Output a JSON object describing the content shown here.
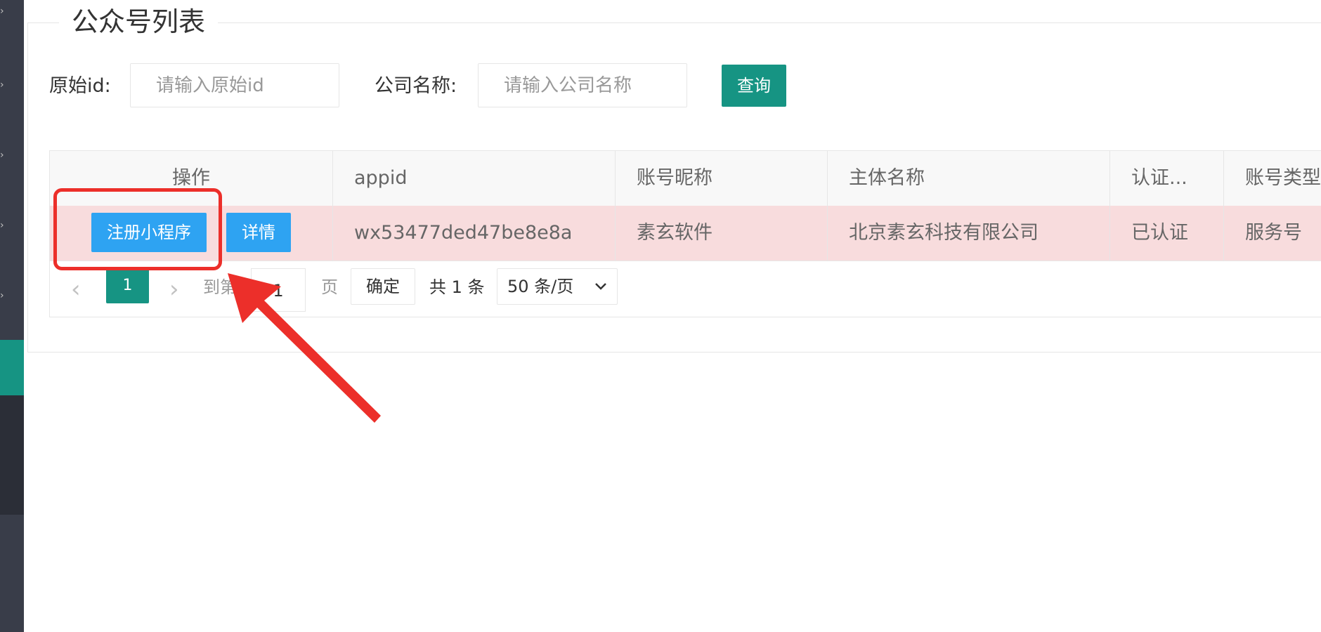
{
  "page_title": "公众号列表",
  "search": {
    "original_id_label": "原始id:",
    "original_id_placeholder": "请输入原始id",
    "company_label": "公司名称:",
    "company_placeholder": "请输入公司名称",
    "query_button": "查询"
  },
  "table": {
    "headers": [
      "操作",
      "appid",
      "账号昵称",
      "主体名称",
      "认证...",
      "账号类型"
    ],
    "rows": [
      {
        "actions": [
          "注册小程序",
          "详情"
        ],
        "appid": "wx53477ded47be8e8a",
        "nickname": "素玄软件",
        "entity": "北京素玄科技有限公司",
        "verified": "已认证",
        "account_type": "服务号"
      }
    ]
  },
  "pagination": {
    "prev_icon": "chevron-left-icon",
    "current_page": "1",
    "next_icon": "chevron-right-icon",
    "goto_label": "到第",
    "goto_value": "1",
    "page_unit": "页",
    "confirm": "确定",
    "total": "共 1 条",
    "page_size": "50 条/页"
  },
  "colors": {
    "accent": "#169483",
    "blue_button": "#2ea3f2",
    "row_highlight": "#f8dcdd",
    "annotation_red": "#ec2f2a",
    "sidebar": "#393d49"
  }
}
